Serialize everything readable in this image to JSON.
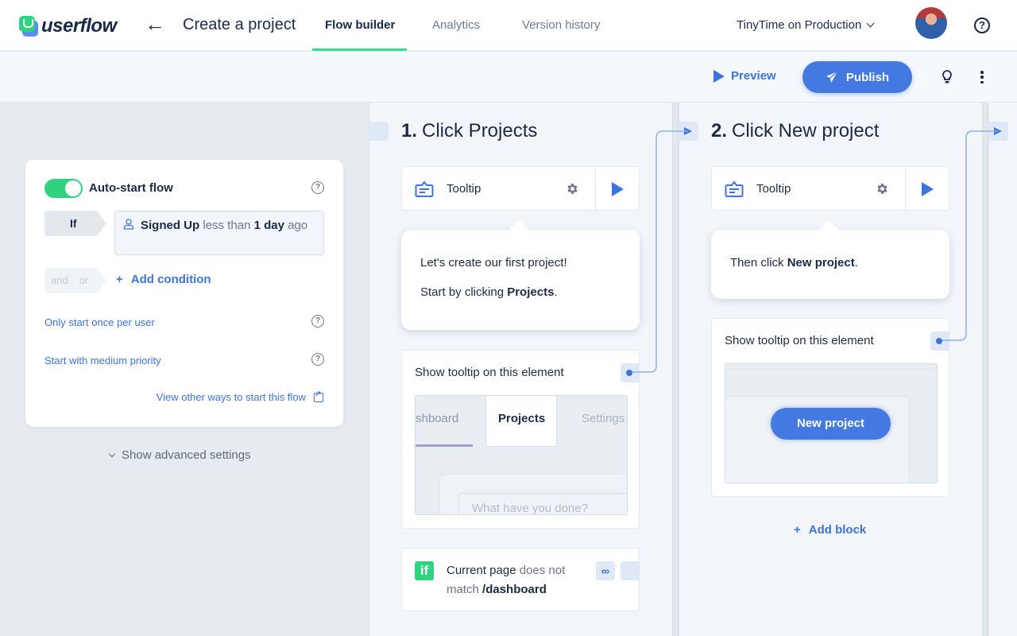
{
  "header": {
    "brand": "userflow",
    "back_icon": "arrow-left-icon",
    "title": "Create a project",
    "tabs": [
      {
        "label": "Flow builder",
        "active": true
      },
      {
        "label": "Analytics",
        "active": false
      },
      {
        "label": "Version history",
        "active": false
      }
    ],
    "environment": "TinyTime on Production",
    "help_icon": "question-circle-icon",
    "accent_color": "#2fe08a"
  },
  "toolbar": {
    "preview_label": "Preview",
    "publish_label": "Publish",
    "primary_color": "#4379e0"
  },
  "trigger": {
    "auto_start_label": "Auto-start flow",
    "auto_start_enabled": true,
    "if_label": "If",
    "condition": {
      "attribute": "Signed Up",
      "operator": "less than",
      "value": "1 day",
      "suffix": "ago"
    },
    "and_label": "and",
    "or_label": "or",
    "add_condition_label": "Add condition",
    "once_per_user_label": "Only start once per user",
    "priority_label": "Start with medium priority",
    "view_ways_label": "View other ways to start this flow",
    "advanced_label": "Show advanced settings"
  },
  "steps": [
    {
      "number": "1.",
      "title": "Click Projects",
      "block_type": "Tooltip",
      "tooltip_lines": [
        {
          "text": "Let's create our first project!",
          "bold": ""
        },
        {
          "text": "Start by clicking ",
          "bold": "Projects",
          "end": "."
        }
      ],
      "target_label": "Show tooltip on this element",
      "preview": {
        "tabs": [
          "shboard",
          "Projects",
          "Settings"
        ],
        "input_placeholder": "What have you done?"
      },
      "condition": {
        "subject": "Current page",
        "operator_1": "does not",
        "operator_2": "match",
        "value": "/dashboard"
      }
    },
    {
      "number": "2.",
      "title": "Click New project",
      "block_type": "Tooltip",
      "tooltip_lines": [
        {
          "text": "Then click ",
          "bold": "New project",
          "end": "."
        }
      ],
      "target_label": "Show tooltip on this element",
      "preview": {
        "button_label": "New project"
      },
      "add_block_label": "Add block"
    }
  ]
}
